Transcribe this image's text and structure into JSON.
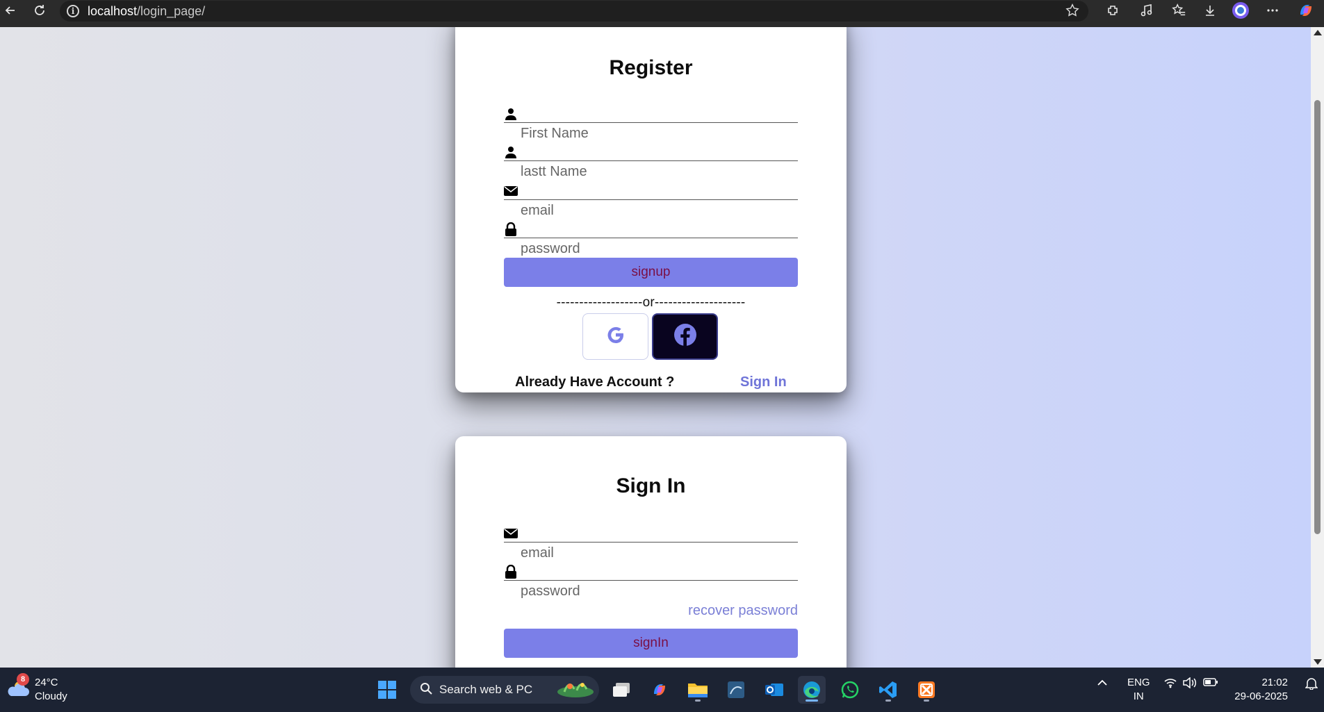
{
  "browser": {
    "url_host": "localhost",
    "url_path": "/login_page/"
  },
  "register": {
    "title": "Register",
    "fields": [
      {
        "icon": "user-icon",
        "placeholder": "First Name"
      },
      {
        "icon": "user-icon",
        "placeholder": "lastt Name"
      },
      {
        "icon": "envelope-icon",
        "placeholder": "email"
      },
      {
        "icon": "lock-icon",
        "placeholder": "password"
      }
    ],
    "signup_label": "signup",
    "divider": "-------------------or--------------------",
    "social": [
      {
        "name": "google",
        "icon": "google-icon"
      },
      {
        "name": "facebook",
        "icon": "facebook-icon"
      }
    ],
    "already_text": "Already Have Account ?",
    "signin_link": "Sign In"
  },
  "signin": {
    "title": "Sign In",
    "fields": [
      {
        "icon": "envelope-icon",
        "placeholder": "email"
      },
      {
        "icon": "lock-icon",
        "placeholder": "password"
      }
    ],
    "recover_label": "recover password",
    "signin_label": "signIn"
  },
  "taskbar": {
    "weather_temp": "24°C",
    "weather_desc": "Cloudy",
    "weather_badge": "8",
    "search_label": "Search web & PC",
    "lang_line1": "ENG",
    "lang_line2": "IN",
    "time": "21:02",
    "date": "29-06-2025"
  },
  "colors": {
    "accent": "#7b7fe8",
    "link": "#6f74d8",
    "button_text": "#7a0f44"
  }
}
